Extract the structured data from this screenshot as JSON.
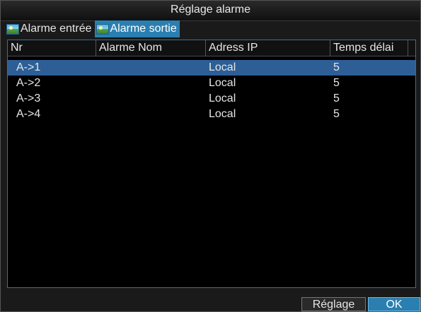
{
  "window": {
    "title": "Réglage alarme"
  },
  "tabs": [
    {
      "label": "Alarme entrée",
      "active": false
    },
    {
      "label": "Alarme sortie",
      "active": true
    }
  ],
  "table": {
    "columns": [
      "Nr",
      "Alarme Nom",
      "Adress IP",
      "Temps délai"
    ],
    "rows": [
      {
        "nr": "A->1",
        "name": "",
        "ip": "Local",
        "delay": "5"
      },
      {
        "nr": "A->2",
        "name": "",
        "ip": "Local",
        "delay": "5"
      },
      {
        "nr": "A->3",
        "name": "",
        "ip": "Local",
        "delay": "5"
      },
      {
        "nr": "A->4",
        "name": "",
        "ip": "Local",
        "delay": "5"
      }
    ],
    "selected_row": 0,
    "focused_row": 2
  },
  "buttons": {
    "reglage": "Réglage",
    "ok": "OK"
  },
  "colors": {
    "accent": "#2a7fb0",
    "selection": "#2d5f96"
  }
}
